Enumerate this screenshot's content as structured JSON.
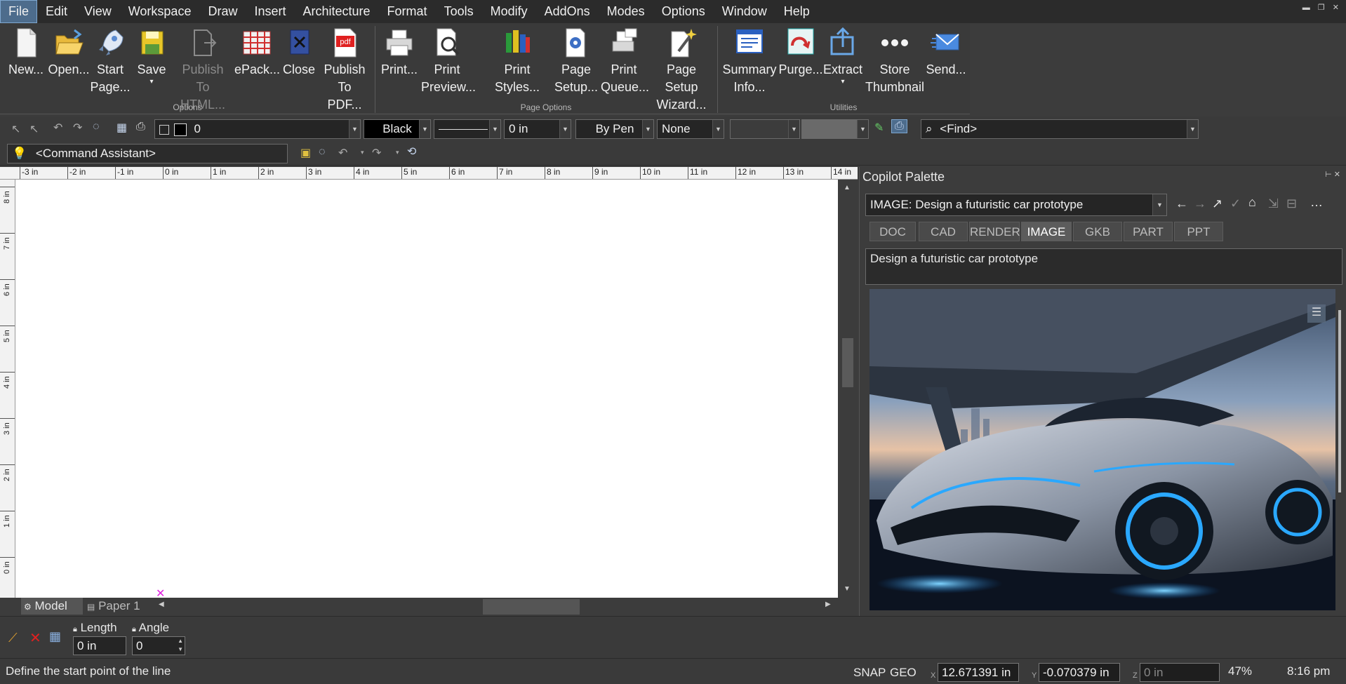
{
  "menubar": {
    "items": [
      "File",
      "Edit",
      "View",
      "Workspace",
      "Draw",
      "Insert",
      "Architecture",
      "Format",
      "Tools",
      "Modify",
      "AddOns",
      "Modes",
      "Options",
      "Window",
      "Help"
    ]
  },
  "ribbon": {
    "buttons": [
      {
        "l1": "New...",
        "l2": ""
      },
      {
        "l1": "Open...",
        "l2": ""
      },
      {
        "l1": "Start",
        "l2": "Page..."
      },
      {
        "l1": "Save",
        "l2": ""
      },
      {
        "l1": "Publish",
        "l2": "To HTML..."
      },
      {
        "l1": "ePack...",
        "l2": ""
      },
      {
        "l1": "Close",
        "l2": ""
      },
      {
        "l1": "Publish",
        "l2": "To PDF..."
      },
      {
        "l1": "Print...",
        "l2": ""
      },
      {
        "l1": "Print",
        "l2": "Preview..."
      },
      {
        "l1": "Print Styles...",
        "l2": ""
      },
      {
        "l1": "Page",
        "l2": "Setup..."
      },
      {
        "l1": "Print",
        "l2": "Queue..."
      },
      {
        "l1": "Page Setup",
        "l2": "Wizard..."
      },
      {
        "l1": "Summary",
        "l2": "Info..."
      },
      {
        "l1": "Purge...",
        "l2": ""
      },
      {
        "l1": "Extract",
        "l2": ""
      },
      {
        "l1": "Store",
        "l2": "Thumbnail"
      },
      {
        "l1": "Send...",
        "l2": ""
      }
    ],
    "groups": [
      "Options",
      "Page Options",
      "Utilities"
    ]
  },
  "toolbar": {
    "layer_value": "0",
    "color_value": "Black",
    "width_value": "0 in",
    "pen_value": "By Pen",
    "fill_value": "None",
    "find_placeholder": "<Find>",
    "command_assistant": "<Command Assistant>"
  },
  "ruler": {
    "top_ticks": [
      "-3 in",
      "-2 in",
      "-1 in",
      "0 in",
      "1 in",
      "2 in",
      "3 in",
      "4 in",
      "5 in",
      "6 in",
      "7 in",
      "8 in",
      "9 in",
      "10 in",
      "11 in",
      "12 in",
      "13 in",
      "14 in"
    ],
    "left_ticks": [
      "8 in",
      "7 in",
      "6 in",
      "5 in",
      "4 in",
      "3 in",
      "2 in",
      "1 in",
      "0 in"
    ]
  },
  "sheet_tabs": {
    "model": "Model",
    "paper": "Paper 1"
  },
  "palette": {
    "title": "Copilot Palette",
    "prompt_select": "IMAGE: Design a futuristic car prototype",
    "tabs": [
      "DOC",
      "CAD",
      "RENDER",
      "IMAGE",
      "GKB",
      "PART",
      "PPT"
    ],
    "active_tab": "IMAGE",
    "prompt_text": "Design a futuristic car prototype"
  },
  "cmdbar": {
    "length_label": "Length",
    "angle_label": "Angle",
    "length_value": "0 in",
    "angle_value": "0"
  },
  "status": {
    "message": "Define the start point of the line",
    "snap": "SNAP",
    "geo": "GEO",
    "x_value": "12.671391 in",
    "y_value": "-0.070379 in",
    "z_value": "0 in",
    "zoom": "47%",
    "time": "8:16 pm",
    "x_label": "X",
    "y_label": "Y",
    "z_label": "Z"
  },
  "colors": {
    "accent": "#4d6c8c",
    "car_glow": "#2aa8ff"
  }
}
